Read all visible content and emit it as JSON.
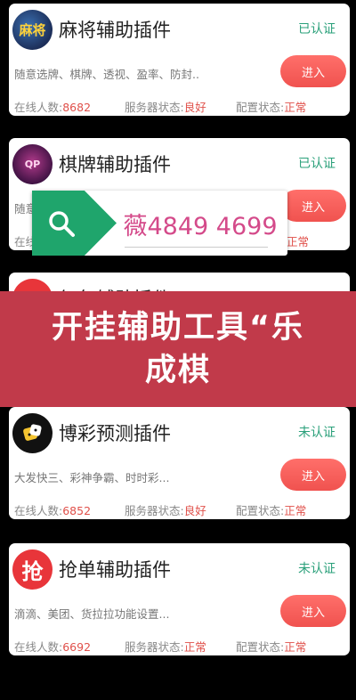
{
  "cards": [
    {
      "title": "麻将辅助插件",
      "avatar_text": "麻将",
      "cert": "已认证",
      "desc": "随意选牌、棋牌、透视、盈率、防封..",
      "button": "进入",
      "online_label": "在线人数:",
      "online_value": "8682",
      "server_label": "服务器状态:",
      "server_value": "良好",
      "config_label": "配置状态:",
      "config_value": "正常"
    },
    {
      "title": "棋牌辅助插件",
      "avatar_text": "QP",
      "cert": "已认证",
      "desc": "随意",
      "button": "进入",
      "online_label": "在线",
      "online_value": "",
      "server_label": "",
      "server_value": "",
      "config_label": "",
      "config_value": "正常"
    },
    {
      "title": "红包辅助插件",
      "avatar_text": ""
    },
    {
      "title": "博彩预测插件",
      "avatar_text": "",
      "cert": "未认证",
      "desc": "大发快三、彩神争霸、时时彩...",
      "button": "进入",
      "online_label": "在线人数:",
      "online_value": "6852",
      "server_label": "服务器状态:",
      "server_value": "良好",
      "config_label": "配置状态:",
      "config_value": "正常"
    },
    {
      "title": "抢单辅助插件",
      "avatar_text": "抢",
      "cert": "未认证",
      "desc": "滴滴、美团、货拉拉功能设置...",
      "button": "进入",
      "online_label": "在线人数:",
      "online_value": "6692",
      "server_label": "服务器状态:",
      "server_value": "正常",
      "config_label": "配置状态:",
      "config_value": "正常"
    }
  ],
  "popup": {
    "text": "薇4849 4699",
    "icon": "search-icon",
    "accent": "#1fa56c"
  },
  "banner": {
    "text": "开挂辅助工具“乐成棋",
    "color": "#c13a4a"
  }
}
